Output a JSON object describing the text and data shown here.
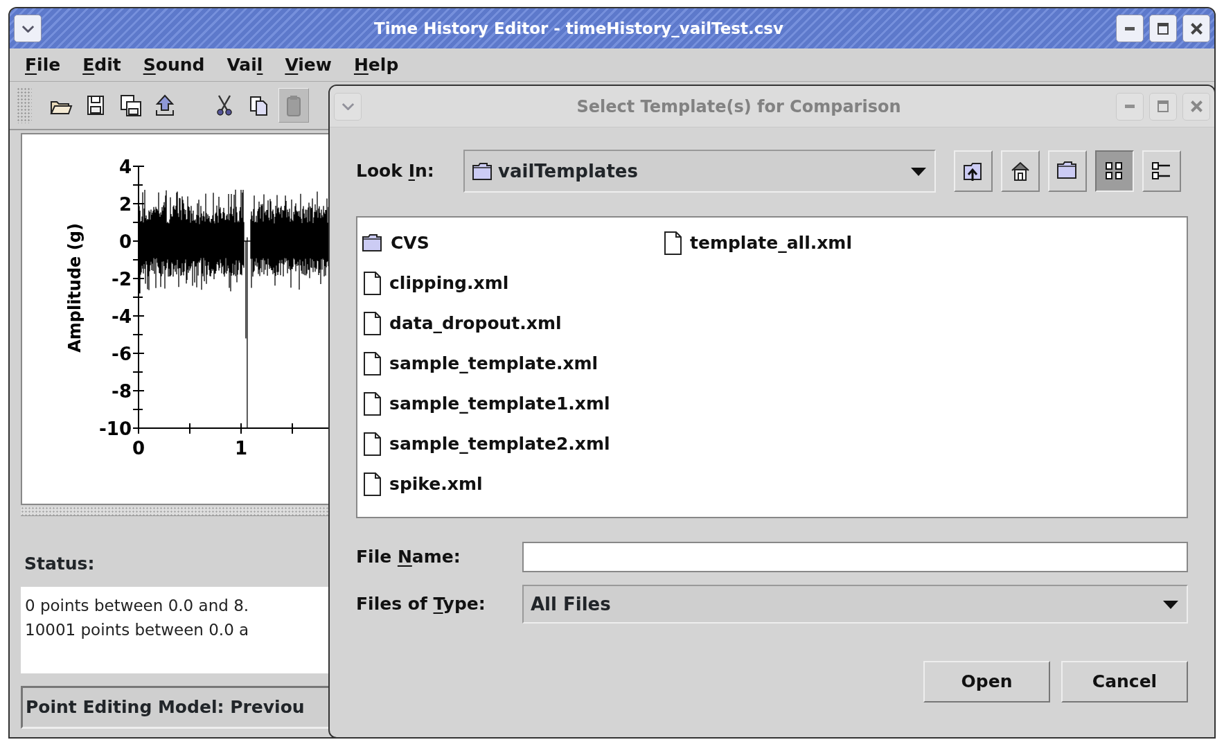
{
  "window": {
    "title": "Time History Editor - timeHistory_vailTest.csv"
  },
  "menu": [
    {
      "key": "F",
      "post": "ile"
    },
    {
      "key": "E",
      "post": "dit"
    },
    {
      "key": "S",
      "post": "ound"
    },
    {
      "pre": "Vai",
      "key": "l"
    },
    {
      "key": "V",
      "post": "iew"
    },
    {
      "key": "H",
      "post": "elp"
    }
  ],
  "toolbar": {
    "groups": [
      [
        {
          "disabled": false
        },
        {
          "disabled": false
        },
        {
          "disabled": false
        },
        {
          "disabled": false
        }
      ],
      [
        {
          "disabled": false
        },
        {
          "disabled": false
        },
        {
          "disabled": true
        }
      ]
    ]
  },
  "plot": {
    "ylabel": "Amplitude (g)",
    "yticks": [
      "4",
      "2",
      "0",
      "-2",
      "-4",
      "-6",
      "-8",
      "-10"
    ],
    "xticks": [
      "0",
      "1"
    ]
  },
  "status": {
    "label": "Status:",
    "lines": [
      "0 points between 0.0 and 8.",
      "10001 points between 0.0 a"
    ]
  },
  "editing_bar": "Point Editing Model: Previou",
  "dialog": {
    "title": "Select Template(s) for Comparison",
    "look_in": {
      "label": {
        "pre": "Look ",
        "key": "I",
        "post": "n:"
      },
      "value": "vailTemplates"
    },
    "tool_buttons": [
      {
        "selected": false
      },
      {
        "selected": false
      },
      {
        "selected": false
      },
      {
        "selected": true
      },
      {
        "selected": false
      }
    ],
    "files": [
      {
        "kind": "folder",
        "name": "CVS"
      },
      {
        "kind": "file",
        "name": "clipping.xml"
      },
      {
        "kind": "file",
        "name": "data_dropout.xml"
      },
      {
        "kind": "file",
        "name": "sample_template.xml"
      },
      {
        "kind": "file",
        "name": "sample_template1.xml"
      },
      {
        "kind": "file",
        "name": "sample_template2.xml"
      },
      {
        "kind": "file",
        "name": "spike.xml"
      },
      {
        "kind": "file",
        "name": "template_all.xml"
      }
    ],
    "file_name": {
      "label": {
        "pre": "File ",
        "key": "N",
        "post": "ame:"
      }
    },
    "file_type": {
      "label": {
        "pre": "Files of ",
        "key": "T",
        "post": "ype:"
      },
      "value": "All Files"
    },
    "buttons": [
      "Open",
      "Cancel"
    ]
  }
}
